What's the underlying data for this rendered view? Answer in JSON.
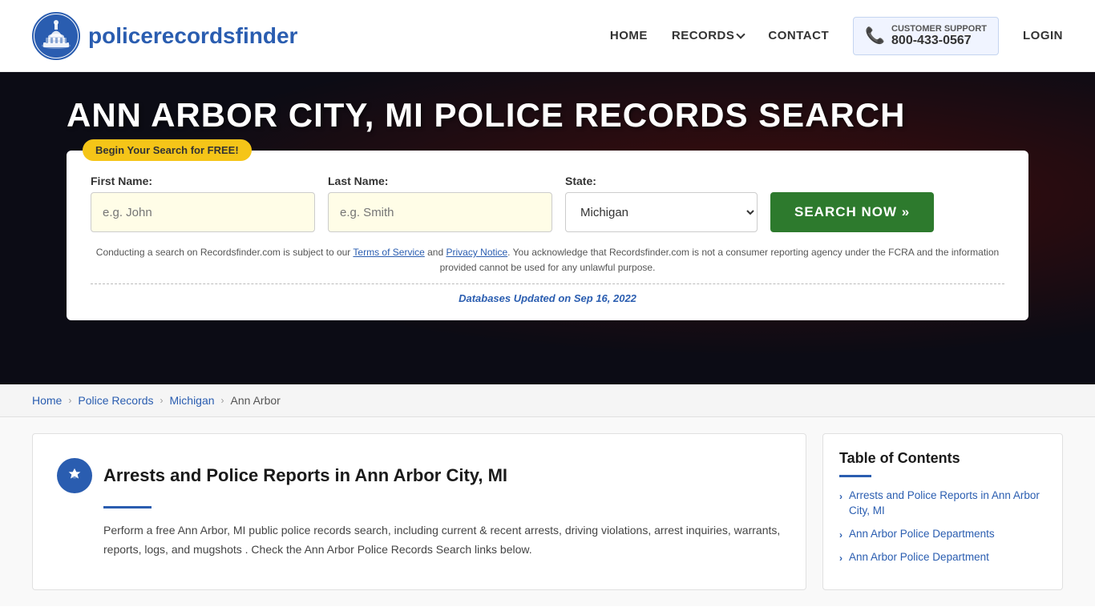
{
  "header": {
    "logo_text_normal": "policerecords",
    "logo_text_bold": "finder",
    "nav": {
      "home": "HOME",
      "records": "RECORDS",
      "contact": "CONTACT",
      "support_label": "CUSTOMER SUPPORT",
      "support_number": "800-433-0567",
      "login": "LOGIN"
    }
  },
  "hero": {
    "title": "ANN ARBOR CITY, MI POLICE RECORDS SEARCH",
    "free_badge": "Begin Your Search for FREE!",
    "search": {
      "first_name_label": "First Name:",
      "first_name_placeholder": "e.g. John",
      "last_name_label": "Last Name:",
      "last_name_placeholder": "e.g. Smith",
      "state_label": "State:",
      "state_value": "Michigan",
      "search_button": "SEARCH NOW »"
    },
    "disclaimer": "Conducting a search on Recordsfinder.com is subject to our Terms of Service and Privacy Notice. You acknowledge that Recordsfinder.com is not a consumer reporting agency under the FCRA and the information provided cannot be used for any unlawful purpose.",
    "db_updated_label": "Databases Updated on",
    "db_updated_date": "Sep 16, 2022"
  },
  "breadcrumb": {
    "home": "Home",
    "police_records": "Police Records",
    "michigan": "Michigan",
    "current": "Ann Arbor"
  },
  "main": {
    "section_title": "Arrests and Police Reports in Ann Arbor City, MI",
    "section_body": "Perform a free Ann Arbor, MI public police records search, including current & recent arrests, driving violations, arrest inquiries, warrants, reports, logs, and mugshots . Check the Ann Arbor Police Records Search links below."
  },
  "toc": {
    "title": "Table of Contents",
    "items": [
      "Arrests and Police Reports in Ann Arbor City, MI",
      "Ann Arbor Police Departments",
      "Ann Arbor Police Department"
    ]
  }
}
